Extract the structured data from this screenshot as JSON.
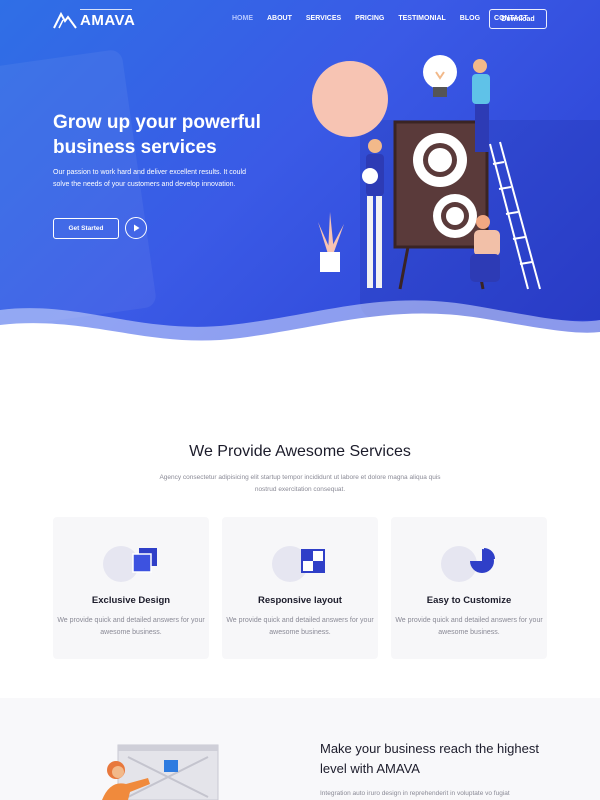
{
  "brand": {
    "name": "AMAVA"
  },
  "nav": {
    "items": [
      {
        "label": "HOME",
        "active": true
      },
      {
        "label": "ABOUT",
        "active": false
      },
      {
        "label": "SERVICES",
        "active": false
      },
      {
        "label": "PRICING",
        "active": false
      },
      {
        "label": "TESTIMONIAL",
        "active": false
      },
      {
        "label": "BLOG",
        "active": false
      },
      {
        "label": "CONTACT",
        "active": false
      }
    ],
    "download_label": "Download"
  },
  "hero": {
    "title": "Grow up your powerful business services",
    "description": "Our passion to work hard and deliver excellent results. It could solve the needs of your customers and develop innovation.",
    "cta_label": "Get Started",
    "play_icon": "play-icon"
  },
  "services": {
    "title": "We Provide Awesome Services",
    "description": "Agency consectetur adipisicing elit startup tempor incididunt ut labore et dolore magna aliqua quis nostrud exercitation consequat.",
    "cards": [
      {
        "title": "Exclusive Design",
        "text": "We provide quick and detailed answers for your awesome business.",
        "icon": "layers-icon"
      },
      {
        "title": "Responsive layout",
        "text": "We provide quick and detailed answers for your awesome business.",
        "icon": "grid-icon"
      },
      {
        "title": "Easy to Customize",
        "text": "We provide quick and detailed answers for your awesome business.",
        "icon": "pie-chart-icon"
      }
    ]
  },
  "feature": {
    "title": "Make your business reach the highest level with AMAVA",
    "description": "Integration auto iruro design in reprehenderit in voluptate vo fugiat"
  },
  "colors": {
    "hero_start": "#2f6fe6",
    "hero_end": "#2b3fd2",
    "accent": "#2f3fc8",
    "card_bg": "#f7f7f9"
  }
}
